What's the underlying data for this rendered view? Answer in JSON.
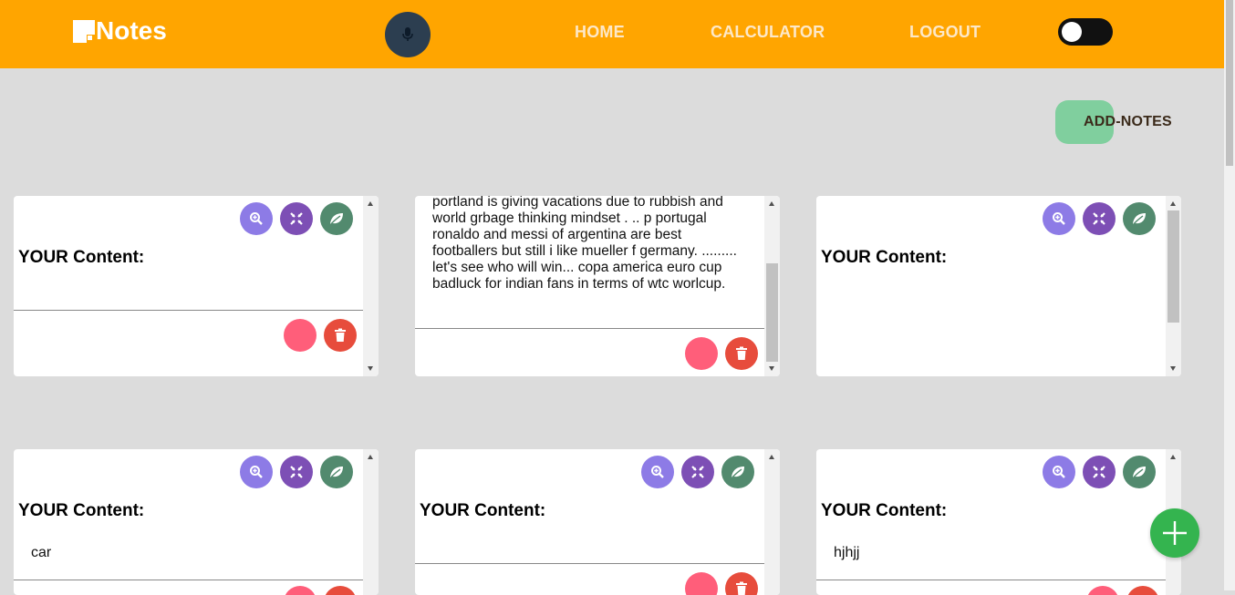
{
  "navbar": {
    "logo_text": "Notes",
    "links": [
      "HOME",
      "CALCULATOR",
      "LOGOUT"
    ],
    "mic_icon": "microphone-icon",
    "theme_toggle": "off"
  },
  "add_notes_label": "ADD-NOTES",
  "card_label": "YOUR Content:",
  "notes": [
    {
      "text": ""
    },
    {
      "text": "portland is giving vacations due to rubbish and world grbage thinking mindset . .. p portugal ronaldo and messi of argentina are best footballers but still i like mueller f germany. ......... let's see who will win... copa america euro cup badluck for indian fans in terms of wtc worlcup."
    },
    {
      "text": ""
    },
    {
      "text": "car"
    },
    {
      "text": ""
    },
    {
      "text": "hjhjj"
    }
  ],
  "icons": {
    "zoom": "zoom-in-icon",
    "shrink": "compress-icon",
    "leaf": "leaf-icon",
    "trash": "trash-icon",
    "add": "plus-icon"
  },
  "colors": {
    "header": "#ffa500",
    "background": "#dcdcdc",
    "add_notes": "#80cf9e",
    "fab": "#34b44f",
    "zoom_button": "#8d7be6",
    "shrink_button": "#7d4fb5",
    "leaf_button": "#528a6e",
    "color_button": "#ff5e7a",
    "delete_button": "#e74c3c"
  }
}
